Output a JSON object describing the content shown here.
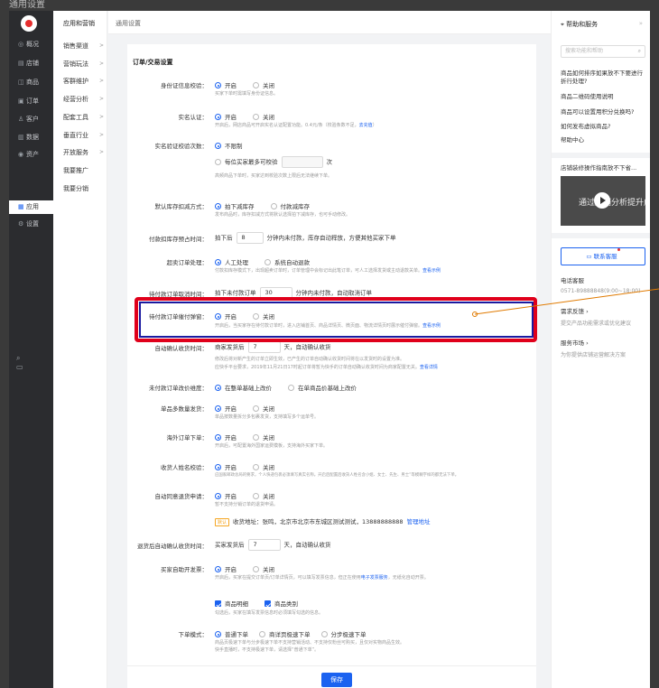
{
  "window_title": "通用设置",
  "nav1": {
    "items": [
      {
        "icon": "◎",
        "label": "概况"
      },
      {
        "icon": "▤",
        "label": "店铺"
      },
      {
        "icon": "◫",
        "label": "商品"
      },
      {
        "icon": "▣",
        "label": "订单"
      },
      {
        "icon": "♙",
        "label": "客户"
      },
      {
        "icon": "▥",
        "label": "数据"
      },
      {
        "icon": "◉",
        "label": "资产"
      },
      {
        "icon": "▦",
        "label": "应用"
      },
      {
        "icon": "⚙",
        "label": "设置"
      }
    ],
    "bottom_icons": "⌕ ▭"
  },
  "nav2": {
    "header": "应用和营销",
    "items": [
      "销售渠道",
      "营销玩法",
      "客群维护",
      "经营分析",
      "配套工具",
      "垂直行业",
      "开放服务",
      "我要推广",
      "我要分销"
    ]
  },
  "breadcrumb": "通用设置",
  "section_title": "订单/交易设置",
  "settings": {
    "id_check": {
      "label": "身份证信息校验：",
      "on": "开启",
      "off": "关闭",
      "hint": "买家下单时需填写身份证信息。"
    },
    "realname": {
      "label": "实名认证：",
      "on": "开启",
      "off": "关闭",
      "hint": "开启后，网店商品可开启实名认证配置功能。0.4元/条（校验条数不足，",
      "hint_link": "去充值",
      "hint_end": "）"
    },
    "realname_count": {
      "label": "实名验证校验次数：",
      "opt1": "不限制",
      "opt2": "每位买家最多可校验",
      "opt2_suffix": "次",
      "hint": "高频商品下单时，买家达到校验次数上限后无法继续下单。"
    },
    "stock_mode": {
      "label": "默认库存扣减方式：",
      "on": "拍下减库存",
      "off": "付款减库存",
      "hint": "发布商品时，库存扣减方式将默认选择拍下减库存，也可手动修改。"
    },
    "pay_deduct": {
      "label": "付款扣库存预占时间：",
      "prefix": "拍下后",
      "value": "8",
      "suffix": "分钟内未付款，库存自动释放，方便其他买家下单"
    },
    "oversell": {
      "label": "超卖订单处理：",
      "on": "人工处理",
      "off": "系统自动退款",
      "hint": "付款扣库存模式下，出现超卖订单时，订单管理中会标记出此笔订单，可人工选择发货或主动退款关单。",
      "hint_link": "查看示例"
    },
    "unpaid_cancel": {
      "label": "待付款订单取消时间：",
      "prefix": "拍下未付款订单",
      "value": "30",
      "suffix": "分钟内未付款，自动取消订单"
    },
    "unpaid_remind": {
      "label": "待付款订单催付弹窗：",
      "on": "开启",
      "off": "关闭",
      "hint": "开启后，当买家存在待付款订单时，进入店铺首页、商品详情页、微页面、物流详情页时展示催付弹窗。",
      "hint_link": "查看示例"
    },
    "auto_confirm": {
      "label": "自动确认收货时间：",
      "prefix": "商家发货后",
      "value": "7",
      "suffix": "天，自动确认收货",
      "hint1": "修改后将对新产生的订单立即生效，已产生的订单自动确认收货时间将在以发货时的设置为准。",
      "hint2": "应快手平台要求，2019年11月21日17时起订单将暂为快手的订单自动确认收货时间为商家配置无关。",
      "hint_link": "查看详情"
    },
    "unpaid_price": {
      "label": "未付款订单改价维度：",
      "on": "在整单基础上改价",
      "off": "在单商品价基础上改价"
    },
    "multi_qty": {
      "label": "单品多数量发货：",
      "on": "开启",
      "off": "关闭",
      "hint": "单品按数量拆分多包裹发货，支持填写多个运单号。"
    },
    "overseas": {
      "label": "海外订单下单：",
      "on": "开启",
      "off": "关闭",
      "hint": "开启后，可配置海外国家运费模板，支持海外买家下单。"
    },
    "receiver_name": {
      "label": "收货人姓名校验：",
      "on": "开启",
      "off": "关闭",
      "hint": "应国家邮政总局的要求，个人快递包裹必须填写真实名称。开启后配置后收货人姓名含小姐、女士、先生、男士”等模糊字样的都无法下单。"
    },
    "auto_refund": {
      "label": "自动同意退货申请：",
      "on": "开启",
      "off": "关闭",
      "hint": "暂不支持分销订单的退货申请。",
      "tag": "默认",
      "address": "收货地址：张鸣，北京市北京市东城区测试测试，13888888888",
      "address_link": "管理地址"
    },
    "refund_confirm": {
      "label": "退货后自动确认收货时间：",
      "prefix": "买家发货后",
      "value": "7",
      "suffix": "天，自动确认收货"
    },
    "invoice": {
      "label": "买家自助开发票：",
      "on": "开启",
      "off": "关闭",
      "hint": "开启后，买家在提交订单页/订单详情页，可以填写发票信息，但正在使用",
      "hint_link": "电子发票服务",
      "hint_end": "，无纸化自动开票。",
      "chk1": "商品明细",
      "chk2": "商品类别",
      "chk_hint": "勾选后，买家在填写发票信息时必须填写勾选的信息。"
    },
    "order_mode": {
      "label": "下单模式：",
      "opt1": "普通下单",
      "opt2": "商详页极速下单",
      "opt3": "分步极速下单",
      "hint1": "商品页极速下单与分步极速下单不支持营销活动、不支持仅粉丝可购买，且仅对实物商品生效。",
      "hint2": "快手直播时，不支持极速下单，请选择“普通下单”。"
    }
  },
  "save_label": "保存",
  "right": {
    "title": "帮助和服务",
    "collapse": "»",
    "search_placeholder": "搜索功能和帮助",
    "faqs": [
      "商品如何排序如果放不下要进行折行处理?",
      "商品二维码使用说明",
      "商品可以设置用积分兑换吗?",
      "如何发布虚拟商品?"
    ],
    "help_center": "帮助中心",
    "video_title": "店铺装修操作指南放不下省...",
    "video_text": "通过店铺分析提升成交",
    "contact": "联系客服",
    "phone_label": "电话客服",
    "phone": "0571-89888848(9:00~18:00)",
    "feedback": "需求反馈 ›",
    "feedback_sub": "提交产品功能需求或优化建议",
    "market": "服务市场 ›",
    "market_sub": "为你提供店铺运营解决方案"
  },
  "colors": {
    "accent": "#1b62f0",
    "highlight_red": "#e0001b",
    "highlight_blue": "#1a1aa0",
    "annotation_arrow": "#e07a00"
  }
}
